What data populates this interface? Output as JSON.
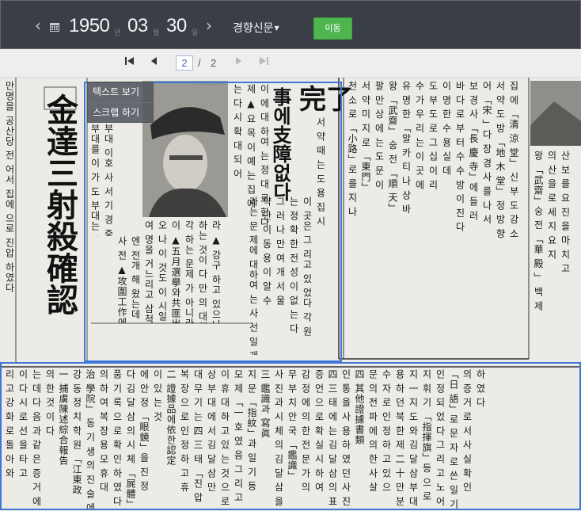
{
  "toolbar": {
    "year": "1950",
    "year_unit": "년",
    "month": "03",
    "month_unit": "월",
    "day": "30",
    "day_unit": "일",
    "newspaper": "경향신문",
    "go_label": "이동"
  },
  "pager": {
    "current_page": "2",
    "separator": "/",
    "total_pages": "2"
  },
  "context_menu": {
    "items": [
      {
        "label": "텍스트 보기"
      },
      {
        "label": "스크랩 하기"
      }
    ]
  },
  "scan": {
    "headlines": {
      "main": "金達三射殺確認",
      "completion": "完了",
      "support": "事에支障없다"
    },
    "columns": [
      "만명을 공산당 전 어서 집에 으로 진압 하였다",
      "이 부대를 이 가 도 부대는 신용 상급 모",
      "이 부대 이호 사 서 기 경 중참 모장",
      "사 전 ▲攻圍工作에의新企圖",
      "엔 전개 해 왔는데 살 지난 에 대 목적",
      "여 명을 거느리고 삼척 「三陟」방면에 준동",
      "오 나 이 것도 이 시일 문제",
      "이 ▲五月選擧와共匪出沒 이 주요 소식",
      "각 하는 문제 가 아니라 그 하는",
      "하는 것이 다 만 의 대책 은 하기",
      "라 ▲ 강구 하고 있으나 이 에 대해",
      "는 다 시 확 대 되 어",
      "제 ▲ 요 목 이 예 는 집 에",
      "이 에 대 하여 는 정 대 로 한다",
      "라는 문 제에 대하여 는 사 선 일 개",
      "약 만 이 동 용 이 알 수",
      "그 러 나 만 여 개 서 울",
      "는 정 확 한 전 성 이 없 는 다",
      "이 곳은 그 리고 있 었다 각 원",
      "서 약 때 는 도 용 집 시",
      "천 소 로 「小路」로 를 지 나",
      "서 약 미 지 로 「東門」",
      "팔 만 상 에 는 도 문 이",
      "왕 「武齋」 숭 전 「順 天」",
      "유 명 한 「알 카 티 나 상 바",
      "수 가 우 리 는 이 곳 에",
      "도 부 도 로 그 십 이 리",
      "이 명 한 수 용 실 데",
      "바 다 로 부 터 수 수 방 이 진 다",
      "보 경 사 「長 慶 寺」에 들 러",
      "어 「宋 」다 장 경 사 를 나 서",
      "서 약 도 방 「地 木 堂」 정 방 향",
      "집 에 「清 涼 堂」 신 부 도 강 소",
      "왕 「武齋」숭 전 「華 殿 」 백 제",
      "의 산 을 로 세 지 요 지",
      "산 보 를 요 진 을 마 치 고",
      "리 고 강 화 로 돌 아 와",
      "이 다 시 로 선 을 타 고",
      "는 데 다 음 과 같 은 증 거 에",
      "의 한 것 이 다",
      "一 捕虜陳述綜合報告",
      "강 동 정 치 학 원 「江東政",
      "治 學院」 동 기 생 의 진 술 에",
      "의 하 여 복 장 용 모 휴 대",
      "품 기 록 으 로 확 인 하 였 다",
      "다 김 달 삼 의 시 체 「屍體」",
      "에 안 정 「眼鏡」을 진 정",
      "이 있 는 것",
      "二 證據品에依한認定",
      "복 장 으 로 인 정 하 고 휴",
      "대 무 기 는 四 三 태 「진 압",
      "상 부 대 에 서 김 달 삼 만",
      "이 휴 대 하 고 있 는 것 으 로",
      "모 제 「一 호 였 음 그 리 고",
      "지 문 「指紋」과 일 기 등",
      "三 鑑識과 寫眞",
      "사 진 과 시 체 의 김 달 삼 을 내",
      "무 부 치 안 국 「鑑識」",
      "감 정 에 의 한 전 문 가 의",
      "증 언 으 로 확 실 시 하 여",
      "四 三 태 에 는 김 달 삼 의 표",
      "인 통 을 사 용 하 였 던 사 진",
      "四 其他證據書類",
      "문 의 전 파 에 의 한 사 살",
      "수 자 로 인 정 하 고 있 으",
      "용 하 던 북 한 제 二 十 만 분",
      "지 一 지 도 와 김 달 삼 부 대",
      "지 휘 기 「指揮旗」등 으 로",
      "인 정 되 었 다 그 리 고 노 어",
      "「日 語」로 문 자 로 쓴 일 기",
      "의 증 거 로 서 사 실 확 인",
      "하 였 다"
    ]
  }
}
